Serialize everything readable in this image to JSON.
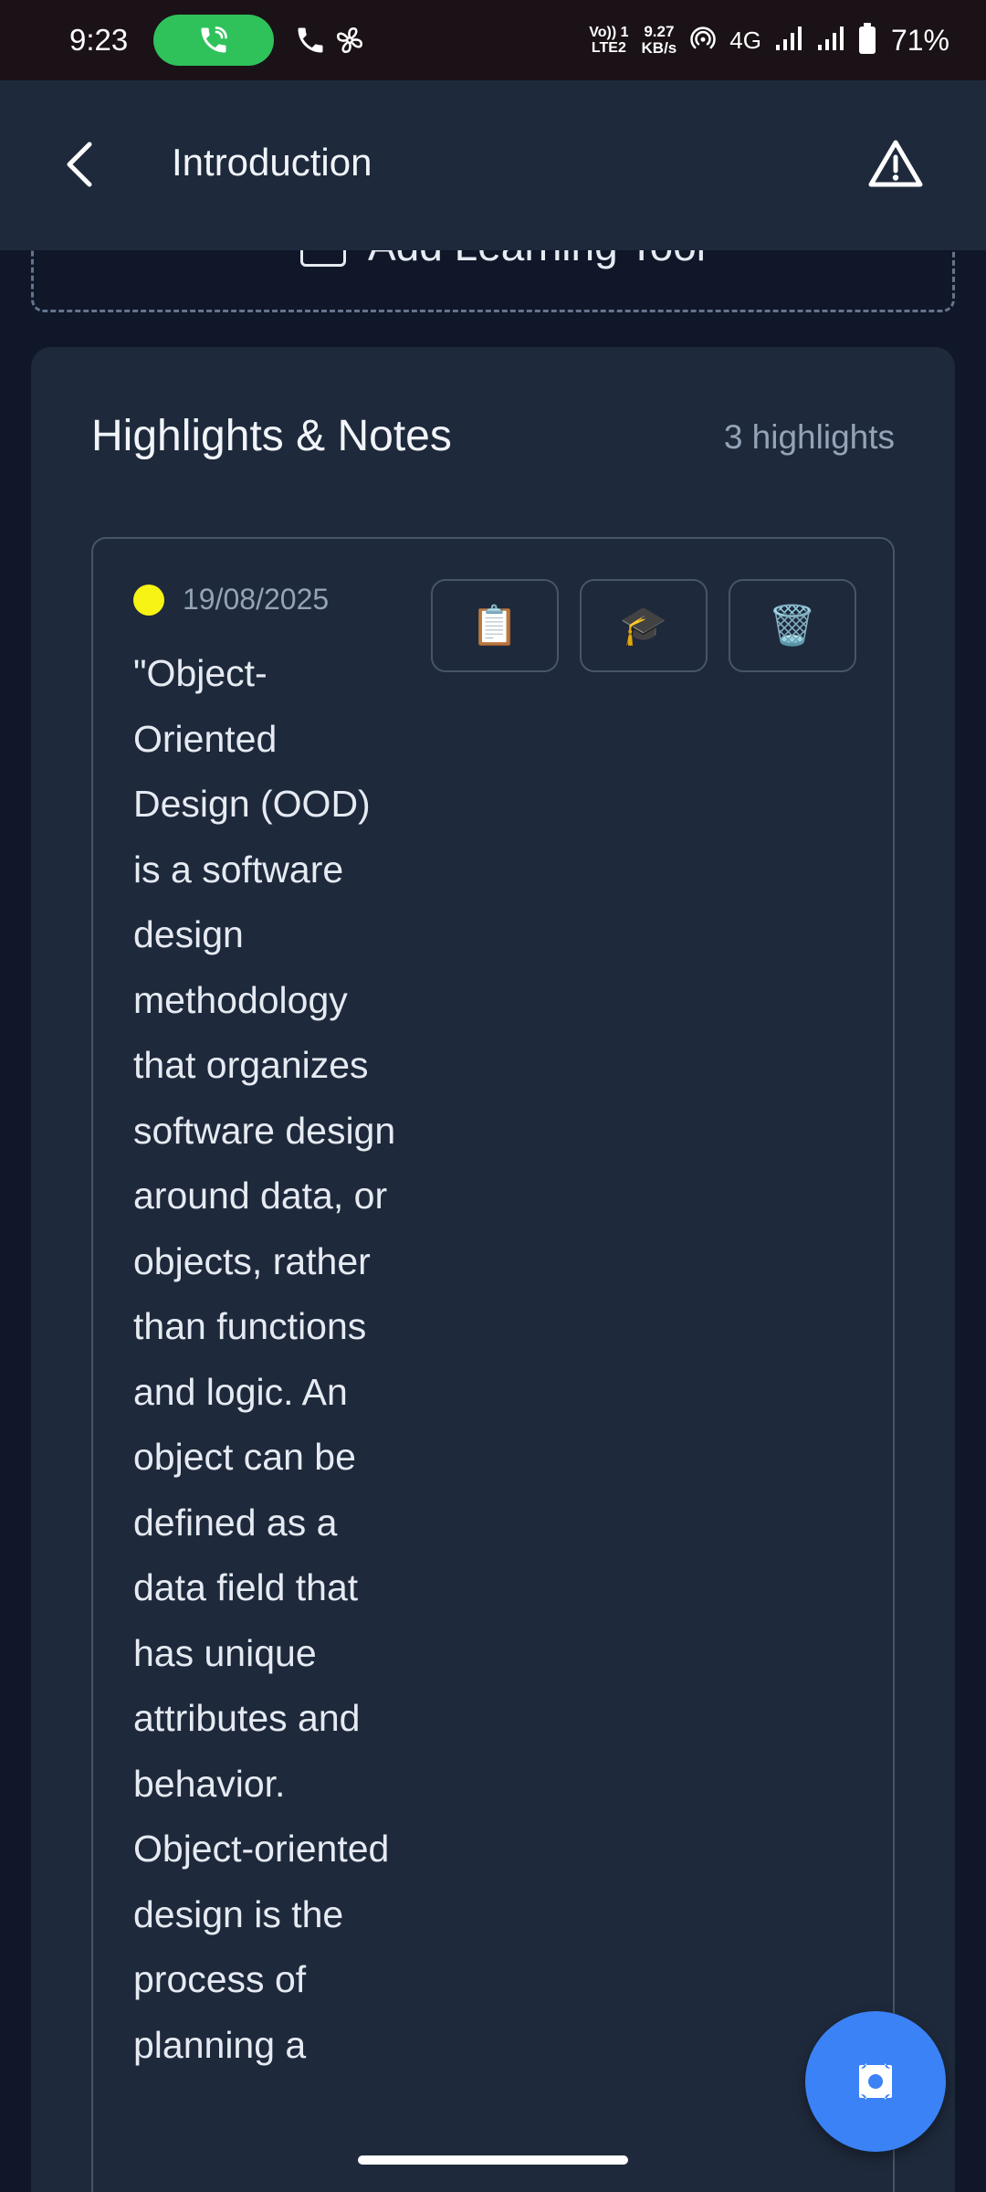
{
  "status_bar": {
    "time": "9:23",
    "volte_line1": "Vo)) 1",
    "volte_line2": "LTE2",
    "speed_value": "9.27",
    "speed_unit": "KB/s",
    "network": "4G",
    "battery": "71%"
  },
  "app_bar": {
    "title": "Introduction"
  },
  "learning_tool": {
    "label": "Add Learning Tool"
  },
  "highlights": {
    "title": "Highlights & Notes",
    "count": "3 highlights",
    "items": [
      {
        "color": "#f7f314",
        "date": "19/08/2025",
        "text": "\"Object-Oriented Design (OOD) is a software design methodology that organizes software design around data, or objects, rather than functions and logic. An object can be defined as a data field that has unique attributes and behavior. Object-oriented design is the process of planning a",
        "actions": [
          "📋",
          "🎓",
          "🗑️"
        ]
      }
    ]
  },
  "colors": {
    "background": "#0f1729",
    "card": "#1e293b",
    "accent": "#3b82f6",
    "highlight_yellow": "#f7f314",
    "call_green": "#2fc25b"
  }
}
